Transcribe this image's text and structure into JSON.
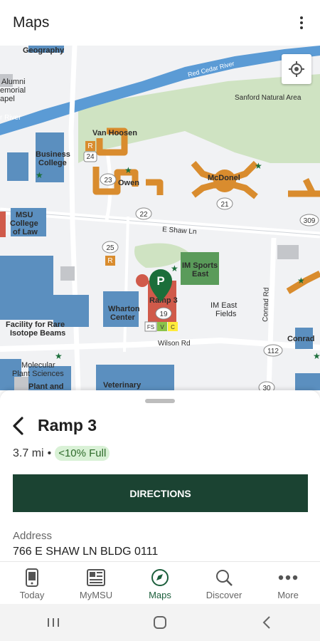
{
  "app_bar": {
    "title": "Maps",
    "more_icon": "more-vert-icon"
  },
  "map": {
    "labels": {
      "geography": "Geography",
      "alumni": "Alumni",
      "memorial": "emorial",
      "chapel": "apel",
      "river": "r River",
      "red_cedar": "Red Cedar River",
      "sanford": "Sanford Natural Area",
      "van_hoosen": "Van Hoosen",
      "business": "Business",
      "college": "College",
      "owen": "Owen",
      "mcdonel": "McDonel",
      "msu": "MSU",
      "college2": "College",
      "of_law": "of Law",
      "shaw": "E Shaw Ln",
      "im_sports": "IM Sports",
      "east": "East",
      "wharton": "Wharton",
      "center": "Center",
      "ramp3": "Ramp 3",
      "im_east": "IM East",
      "fields": "Fields",
      "conrad_rd": "Conrad Rd",
      "frib1": "Facility for Rare",
      "frib2": "Isotope Beams",
      "conrad": "Conrad",
      "wilson": "Wilson Rd",
      "molecular": "Molecular",
      "plant_sci": "Plant Sciences",
      "plant_and": "Plant and",
      "veterinary": "Veterinary",
      "shield_r1": "R",
      "shield_24": "24",
      "shield_23": "23",
      "shield_22": "22",
      "shield_21": "21",
      "shield_309": "309",
      "shield_25": "25",
      "shield_r2": "R",
      "shield_19": "19",
      "shield_112": "112",
      "shield_30": "30",
      "shield_fs": "FS",
      "shield_v": "V",
      "shield_c": "C",
      "pin": "P"
    },
    "colors": {
      "land": "#f1f2f4",
      "green": "#cfe3c2",
      "river": "#5b9bd5",
      "building_blue": "#5b8fbf",
      "dorm_orange": "#d98c2e",
      "parking_red": "#d05a4a",
      "pin_green": "#1b6e3a"
    },
    "locate_icon": "my-location-icon"
  },
  "sheet": {
    "back_icon": "chevron-left-icon",
    "title": "Ramp 3",
    "distance": "3.7 mi",
    "separator": "•",
    "capacity_badge": "<10% Full",
    "directions_label": "DIRECTIONS",
    "address_label": "Address",
    "address_value": "766 E SHAW LN BLDG 0111"
  },
  "bottom_nav": {
    "items": [
      {
        "label": "Today",
        "icon": "phone-icon",
        "active": false
      },
      {
        "label": "MyMSU",
        "icon": "newspaper-icon",
        "active": false
      },
      {
        "label": "Maps",
        "icon": "compass-icon",
        "active": true
      },
      {
        "label": "Discover",
        "icon": "search-icon",
        "active": false
      },
      {
        "label": "More",
        "icon": "more-horiz-icon",
        "active": false
      }
    ],
    "accent": "#1b5e3b"
  },
  "system_nav": {
    "icons": [
      "recents-icon",
      "home-icon",
      "back-icon"
    ]
  }
}
